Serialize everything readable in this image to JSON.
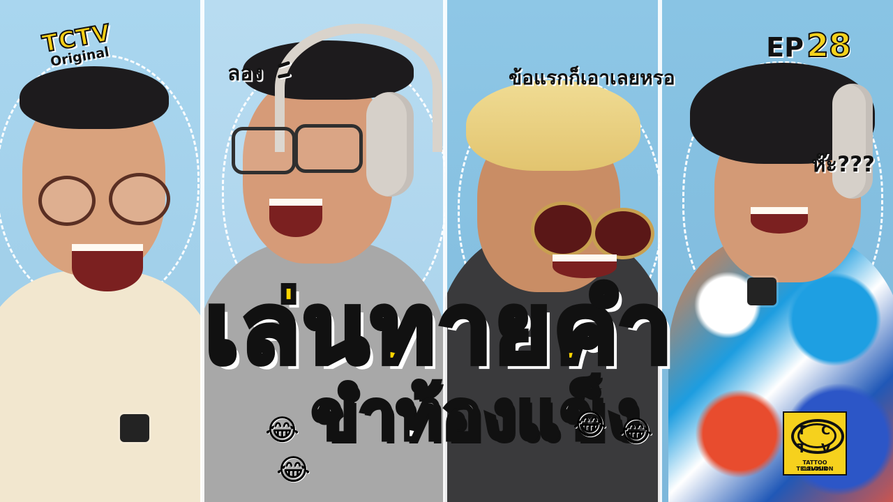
{
  "branding": {
    "top_logo_line1": "TCTV",
    "top_logo_line2": "Original",
    "episode_prefix": "EP",
    "episode_number": "28",
    "corner_logo_t1": "T",
    "corner_logo_c": "C",
    "corner_logo_t2": "T",
    "corner_logo_v": "V",
    "corner_logo_line1": "TATTOO COLOUR",
    "corner_logo_line2": "TELEVISION"
  },
  "speech": {
    "person2": "ลอง",
    "person3": "ข้อแรกก็เอาเลยหรอ",
    "person4": "ห๊ะ???"
  },
  "title": {
    "main": "เล่นทายคำ",
    "sub": "ขำท้องแข็ง"
  },
  "icons": {
    "laughing_emoji": "😂"
  },
  "colors": {
    "title_yellow": "#ffd400",
    "text_outline": "#111111",
    "background_blue": "#8dc2e3"
  }
}
